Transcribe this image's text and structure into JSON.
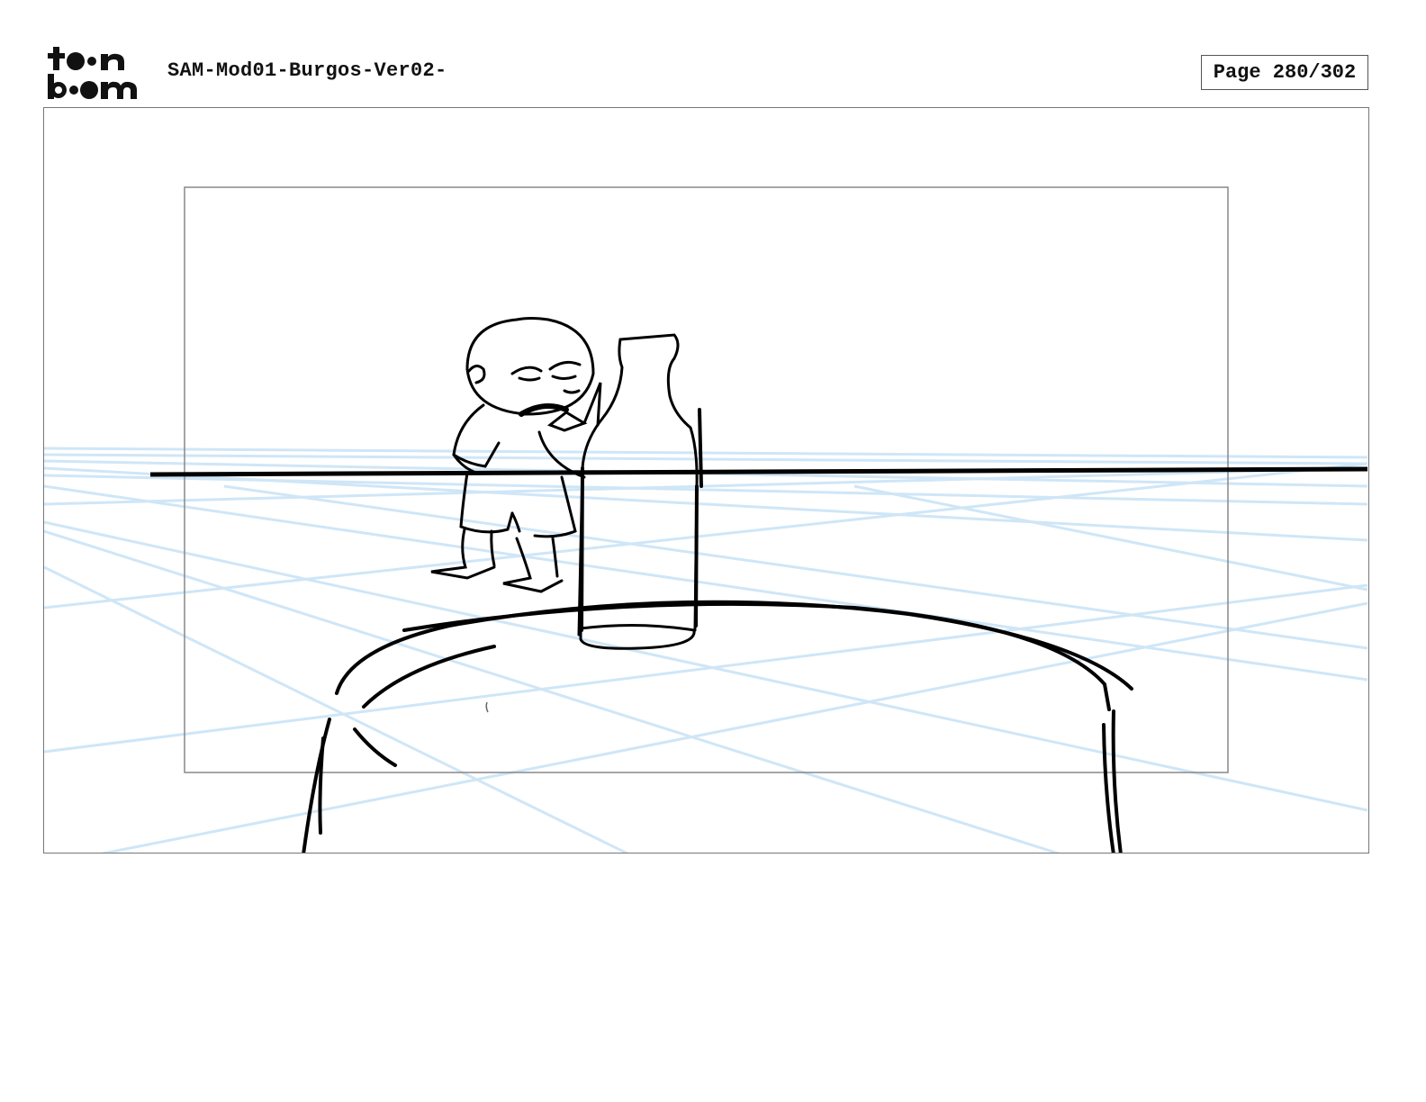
{
  "header": {
    "logo_text": "toon boom",
    "document_title": "SAM-Mod01-Burgos-Ver02-",
    "page_label": "Page 280/302"
  },
  "panel": {
    "sketch_colors": {
      "ink": "#000000",
      "guide_lines": "#cfe6f7",
      "safe_frame": "#888888"
    }
  }
}
